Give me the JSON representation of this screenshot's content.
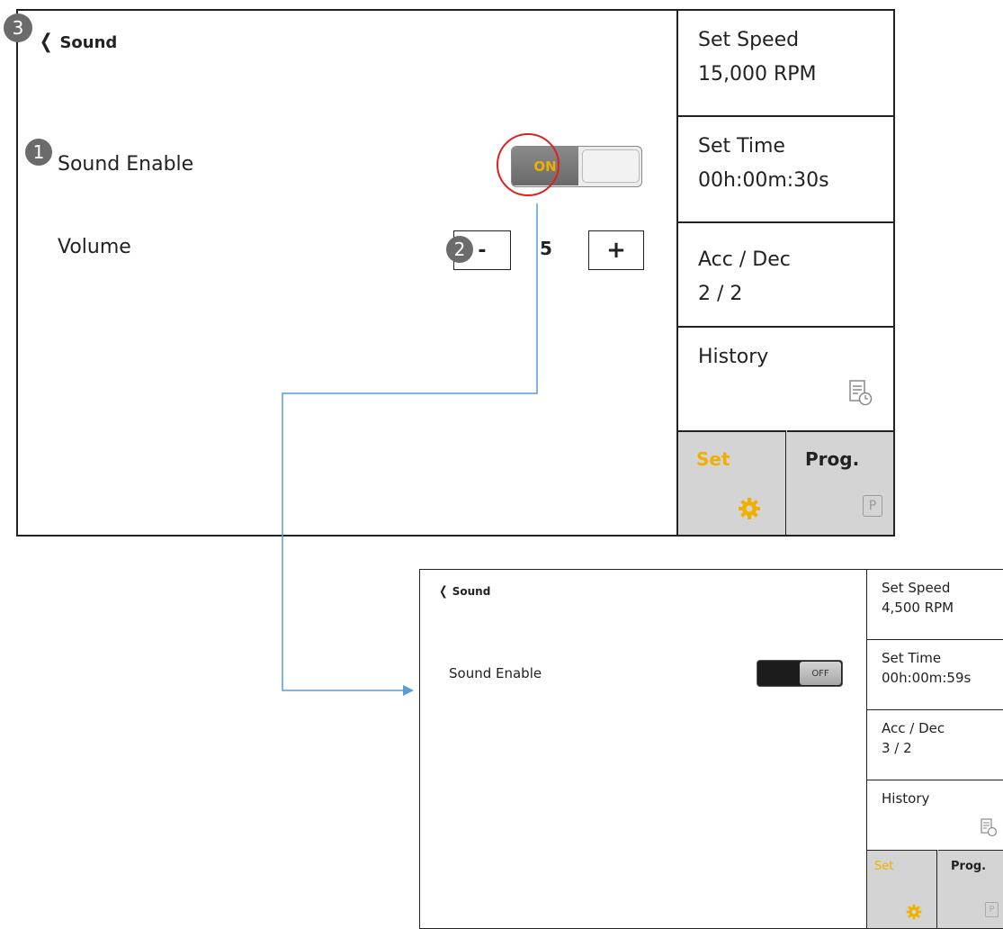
{
  "colors": {
    "accent": "#f0b000",
    "border": "#222222",
    "tab_bg": "#d4d4d4",
    "flow_line": "#5b9bd5",
    "highlight_circle": "#e02020",
    "badge": "#6b6b6b"
  },
  "badges": [
    "1",
    "2",
    "3"
  ],
  "screen1": {
    "back_label": "Sound",
    "sound_enable_label": "Sound Enable",
    "toggle_state": "ON",
    "volume_label": "Volume",
    "volume_minus": "-",
    "volume_value": "5",
    "volume_plus": "+",
    "sidebar": {
      "speed_title": "Set Speed",
      "speed_value": "15,000 RPM",
      "time_title": "Set Time",
      "time_value": "00h:00m:30s",
      "acc_title": "Acc / Dec",
      "acc_value": "2 / 2",
      "history_title": "History",
      "tab_set": "Set",
      "tab_prog": "Prog.",
      "prog_icon_letter": "P"
    }
  },
  "screen2": {
    "back_label": "Sound",
    "sound_enable_label": "Sound Enable",
    "toggle_state": "OFF",
    "sidebar": {
      "speed_title": "Set Speed",
      "speed_value": "4,500 RPM",
      "time_title": "Set Time",
      "time_value": "00h:00m:59s",
      "acc_title": "Acc / Dec",
      "acc_value": "3 / 2",
      "history_title": "History",
      "tab_set": "Set",
      "tab_prog": "Prog.",
      "prog_icon_letter": "P"
    }
  }
}
